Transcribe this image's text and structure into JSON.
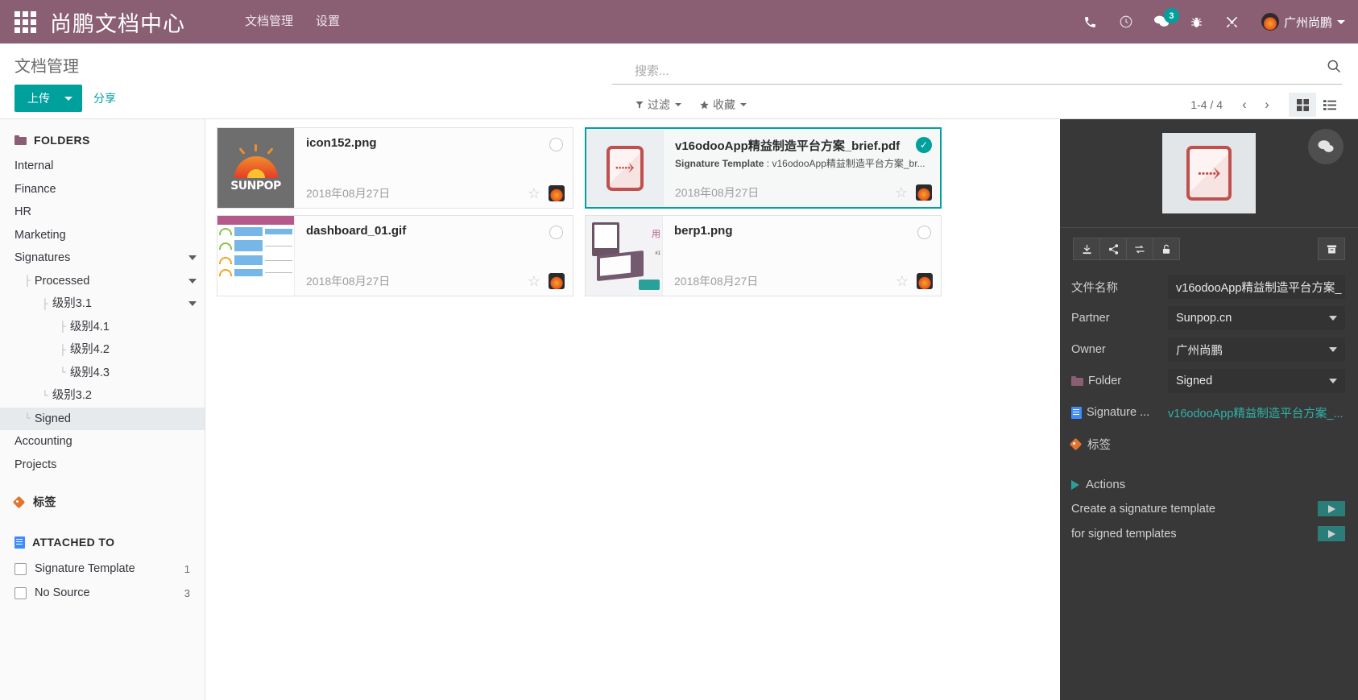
{
  "topbar": {
    "brand": "尚鹏文档中心",
    "menu": [
      {
        "label": "文档管理"
      },
      {
        "label": "设置"
      }
    ],
    "icons": [
      {
        "name": "phone-icon"
      },
      {
        "name": "clock-icon"
      },
      {
        "name": "chat-icon",
        "badge": "3"
      },
      {
        "name": "bug-icon"
      },
      {
        "name": "tools-icon"
      }
    ],
    "user": "广州尚鹏"
  },
  "control": {
    "page_title": "文档管理",
    "upload_label": "上传",
    "share_label": "分享",
    "search_placeholder": "搜索...",
    "search_value": "",
    "filter_label": "过滤",
    "favorites_label": "收藏",
    "pager_count": "1-4 / 4"
  },
  "sidebar": {
    "folders_header": "FOLDERS",
    "folders": [
      {
        "label": "Internal",
        "level": 0,
        "caret": false,
        "selected": false
      },
      {
        "label": "Finance",
        "level": 0,
        "caret": false,
        "selected": false
      },
      {
        "label": "HR",
        "level": 0,
        "caret": false,
        "selected": false
      },
      {
        "label": "Marketing",
        "level": 0,
        "caret": false,
        "selected": false
      },
      {
        "label": "Signatures",
        "level": 0,
        "caret": true,
        "selected": false
      },
      {
        "label": "Processed",
        "level": 1,
        "caret": true,
        "selected": false
      },
      {
        "label": "级别3.1",
        "level": 2,
        "caret": true,
        "selected": false
      },
      {
        "label": "级别4.1",
        "level": 3,
        "caret": false,
        "selected": false
      },
      {
        "label": "级别4.2",
        "level": 3,
        "caret": false,
        "selected": false
      },
      {
        "label": "级别4.3",
        "level": 3,
        "caret": false,
        "selected": false
      },
      {
        "label": "级别3.2",
        "level": 2,
        "caret": false,
        "selected": false
      },
      {
        "label": "Signed",
        "level": 1,
        "caret": false,
        "selected": true
      },
      {
        "label": "Accounting",
        "level": 0,
        "caret": false,
        "selected": false
      },
      {
        "label": "Projects",
        "level": 0,
        "caret": false,
        "selected": false
      }
    ],
    "tags_header": "标签",
    "attached_header": "ATTACHED TO",
    "attached": [
      {
        "label": "Signature Template",
        "count": "1"
      },
      {
        "label": "No Source",
        "count": "3"
      }
    ]
  },
  "files": [
    {
      "name": "icon152.png",
      "subtitle": "",
      "date": "2018年08月27日",
      "thumb": "sunpop-logo-thumb",
      "selected": false
    },
    {
      "name": "v16odooApp精益制造平台方案_brief.pdf",
      "subtitle_label": "Signature Template",
      "subtitle_value": "v16odooApp精益制造平台方案_br...",
      "date": "2018年08月27日",
      "thumb": "pdf-thumb",
      "selected": true
    },
    {
      "name": "dashboard_01.gif",
      "subtitle": "",
      "date": "2018年08月27日",
      "thumb": "dashboard-thumb",
      "selected": false
    },
    {
      "name": "berp1.png",
      "subtitle": "",
      "date": "2018年08月27日",
      "thumb": "berp-thumb",
      "selected": false
    }
  ],
  "inspector": {
    "toolbar_icons": [
      {
        "name": "download-icon"
      },
      {
        "name": "share-icon"
      },
      {
        "name": "replace-icon"
      },
      {
        "name": "lock-icon"
      },
      {
        "name": "archive-icon"
      }
    ],
    "fields": [
      {
        "label": "文件名称",
        "value": "v16odooApp精益制造平台方案_",
        "type": "text"
      },
      {
        "label": "Partner",
        "value": "Sunpop.cn",
        "type": "select"
      },
      {
        "label": "Owner",
        "value": "广州尚鹏",
        "type": "select"
      },
      {
        "label": "Folder",
        "value": "Signed",
        "type": "select",
        "icon": "folder-icon"
      },
      {
        "label": "Signature ...",
        "value": "v16odooApp精益制造平台方案_...",
        "type": "link",
        "icon": "document-icon"
      },
      {
        "label": "标签",
        "value": "",
        "type": "tags",
        "icon": "tag-icon"
      }
    ],
    "actions_header": "Actions",
    "actions": [
      {
        "label": "Create a signature template"
      },
      {
        "label": "for signed templates"
      }
    ]
  },
  "colors": {
    "brand_purple": "#8a5f74",
    "accent_teal": "#00a09d",
    "inspector_bg": "#383838"
  }
}
